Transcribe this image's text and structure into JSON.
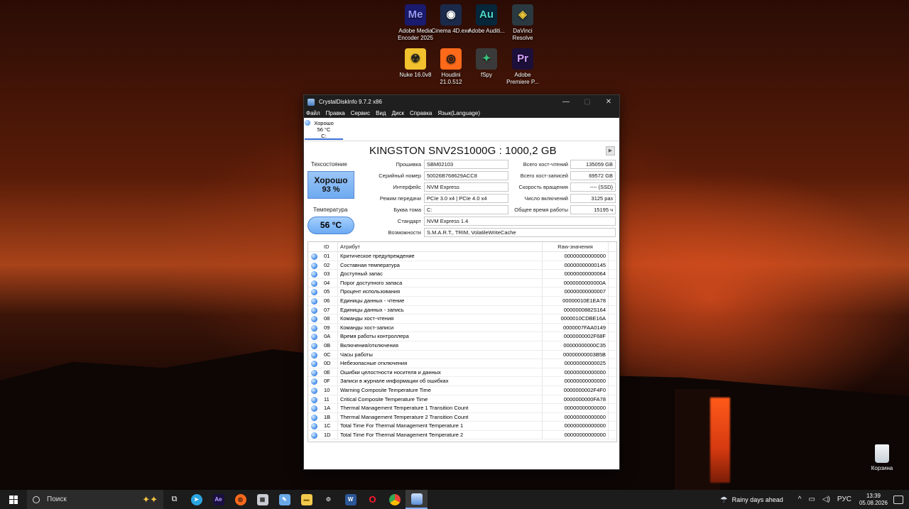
{
  "desktop": {
    "icons": [
      {
        "label": "Adobe Media Encoder 2025",
        "glyph": "Me",
        "color": "#1a1a6e",
        "fg": "#9999ff"
      },
      {
        "label": "Cinema 4D.exe",
        "glyph": "◉",
        "color": "#1b2a4a",
        "fg": "#ffffff"
      },
      {
        "label": "Adobe Auditi...",
        "glyph": "Au",
        "color": "#06263a",
        "fg": "#4dd8c9"
      },
      {
        "label": "DaVinci Resolve",
        "glyph": "◈",
        "color": "#2b3940",
        "fg": "#e9c63a"
      },
      {
        "label": "Nuke 16.0v8",
        "glyph": "☢",
        "color": "#f2c12e",
        "fg": "#222222"
      },
      {
        "label": "Houdini 21.0.512",
        "glyph": "◎",
        "color": "#ff6a1a",
        "fg": "#1a1a1a"
      },
      {
        "label": "fSpy",
        "glyph": "✦",
        "color": "#3a3a3a",
        "fg": "#3ac07c"
      },
      {
        "label": "Adobe Premiere P...",
        "glyph": "Pr",
        "color": "#1c0f3a",
        "fg": "#d8a3ff"
      }
    ],
    "recycle_label": "Корзина"
  },
  "window": {
    "title": "CrystalDiskInfo 9.7.2 x86",
    "minimize": "—",
    "maximize": "▢",
    "close": "✕",
    "menu": [
      "Файл",
      "Правка",
      "Сервис",
      "Вид",
      "Диск",
      "Справка",
      "Язык(Language)"
    ],
    "disk_tab": {
      "status": "Хорошо",
      "temp": "56 °C",
      "letter": "C:"
    },
    "disk_name": "KINGSTON SNV2S1000G : 1000,2 GB",
    "health_label": "Техсостояние",
    "health_status": "Хорошо",
    "health_percent": "93 %",
    "temperature_label": "Температура",
    "temperature_value": "56 °C",
    "left_fields": [
      {
        "label": "Прошивка",
        "value": "SBM02103"
      },
      {
        "label": "Серийный номер",
        "value": "50026B768629ACC8"
      },
      {
        "label": "Интерфейс",
        "value": "NVM Express"
      },
      {
        "label": "Режим передачи",
        "value": "PCIe 3.0 x4 | PCIe 4.0 x4"
      },
      {
        "label": "Буква тома",
        "value": "C:"
      }
    ],
    "right_fields": [
      {
        "label": "Всего хост-чтений",
        "value": "135059 GB"
      },
      {
        "label": "Всего хост-записей",
        "value": "69572 GB"
      },
      {
        "label": "Скорость вращения",
        "value": "---- (SSD)"
      },
      {
        "label": "Число включений",
        "value": "3125 раз"
      },
      {
        "label": "Общее время работы",
        "value": "15195 ч"
      }
    ],
    "standard": {
      "label": "Стандарт",
      "value": "NVM Express 1.4"
    },
    "features": {
      "label": "Возможности",
      "value": "S.M.A.R.T., TRIM, VolatileWriteCache"
    },
    "table": {
      "headers": {
        "id": "ID",
        "attr": "Атрибут",
        "raw": "Raw-значения"
      },
      "rows": [
        {
          "id": "01",
          "attr": "Критическое предупреждение",
          "raw": "00000000000000"
        },
        {
          "id": "02",
          "attr": "Составная температура",
          "raw": "00000000000145"
        },
        {
          "id": "03",
          "attr": "Доступный запас",
          "raw": "00000000000064"
        },
        {
          "id": "04",
          "attr": "Порог доступного запаса",
          "raw": "0000000000000A"
        },
        {
          "id": "05",
          "attr": "Процент использования",
          "raw": "00000000000007"
        },
        {
          "id": "06",
          "attr": "Единицы данных - чтение",
          "raw": "00000010E1EA78"
        },
        {
          "id": "07",
          "attr": "Единицы данных - запись",
          "raw": "0000000882S164"
        },
        {
          "id": "08",
          "attr": "Команды хост-чтения",
          "raw": "0000010CDBE16A"
        },
        {
          "id": "09",
          "attr": "Команды хост-записи",
          "raw": "0000007FAA0149"
        },
        {
          "id": "0A",
          "attr": "Время работы контроллера",
          "raw": "0000000002F68F"
        },
        {
          "id": "0B",
          "attr": "Включения/отключения",
          "raw": "00000000000C35"
        },
        {
          "id": "0C",
          "attr": "Часы работы",
          "raw": "00000000003B5B"
        },
        {
          "id": "0D",
          "attr": "Небезопасные отключения",
          "raw": "00000000000025"
        },
        {
          "id": "0E",
          "attr": "Ошибки целостности носителя и данных",
          "raw": "00000000000000"
        },
        {
          "id": "0F",
          "attr": "Записи в журнале информации об ошибках",
          "raw": "00000000000000"
        },
        {
          "id": "10",
          "attr": "Warning Composite Temperature Time",
          "raw": "0000000002F4F0"
        },
        {
          "id": "11",
          "attr": "Critical Composite Temperature Time",
          "raw": "0000000000FA78"
        },
        {
          "id": "1A",
          "attr": "Thermal Management Temperature 1 Transition Count",
          "raw": "00000000000000"
        },
        {
          "id": "1B",
          "attr": "Thermal Management Temperature 2 Transition Count",
          "raw": "00000000000000"
        },
        {
          "id": "1C",
          "attr": "Total Time For Thermal Management Temperature 1",
          "raw": "00000000000000"
        },
        {
          "id": "1D",
          "attr": "Total Time For Thermal Management Temperature 2",
          "raw": "00000000000000"
        }
      ]
    }
  },
  "taskbar": {
    "search_placeholder": "Поиск",
    "weather": "Rainy days ahead",
    "language": "РУС",
    "time": "13:39",
    "date": "05.08.2026"
  }
}
